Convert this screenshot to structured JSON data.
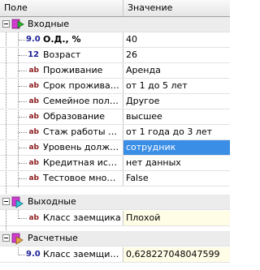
{
  "header": {
    "col_name": "Поле",
    "col_value": "Значение"
  },
  "categories": {
    "inputs": "Входные",
    "outputs": "Выходные",
    "calculated": "Расчетные"
  },
  "rows": [
    {
      "type": "9.0",
      "name": "О.Д., %",
      "value": "40"
    },
    {
      "type": "12",
      "name": "Возраст",
      "value": "26"
    },
    {
      "type": "ab",
      "name": "Проживание",
      "value": "Аренда"
    },
    {
      "type": "ab",
      "name": "Срок проживани...",
      "value": "от 1 до 5 лет"
    },
    {
      "type": "ab",
      "name": "Семейное полож...",
      "value": "Другое"
    },
    {
      "type": "ab",
      "name": "Образование",
      "value": "высшее"
    },
    {
      "type": "ab",
      "name": "Стаж работы на ...",
      "value": "от 1 года до 3 лет"
    },
    {
      "type": "ab",
      "name": "Уровень должно...",
      "value": "сотрудник"
    },
    {
      "type": "ab",
      "name": "Кредитная истор...",
      "value": "нет данных"
    },
    {
      "type": "ab",
      "name": "Тестовое множе...",
      "value": "False"
    },
    {
      "type": "ab",
      "name": "Класс заемщика",
      "value": "Плохой"
    },
    {
      "type": "9.0",
      "name": "Класс заемщика...",
      "value": "0,628227048047599"
    }
  ],
  "colors": {
    "selection": "#3a8ee6",
    "output_bg": "#fffde6",
    "number_type": "#1c1f98",
    "string_type": "#8a1b1b"
  },
  "icons": {
    "collapse": "minus-box-icon",
    "inputs": "input-fields-icon",
    "outputs": "output-fields-icon",
    "calculated": "calculated-fields-icon"
  }
}
